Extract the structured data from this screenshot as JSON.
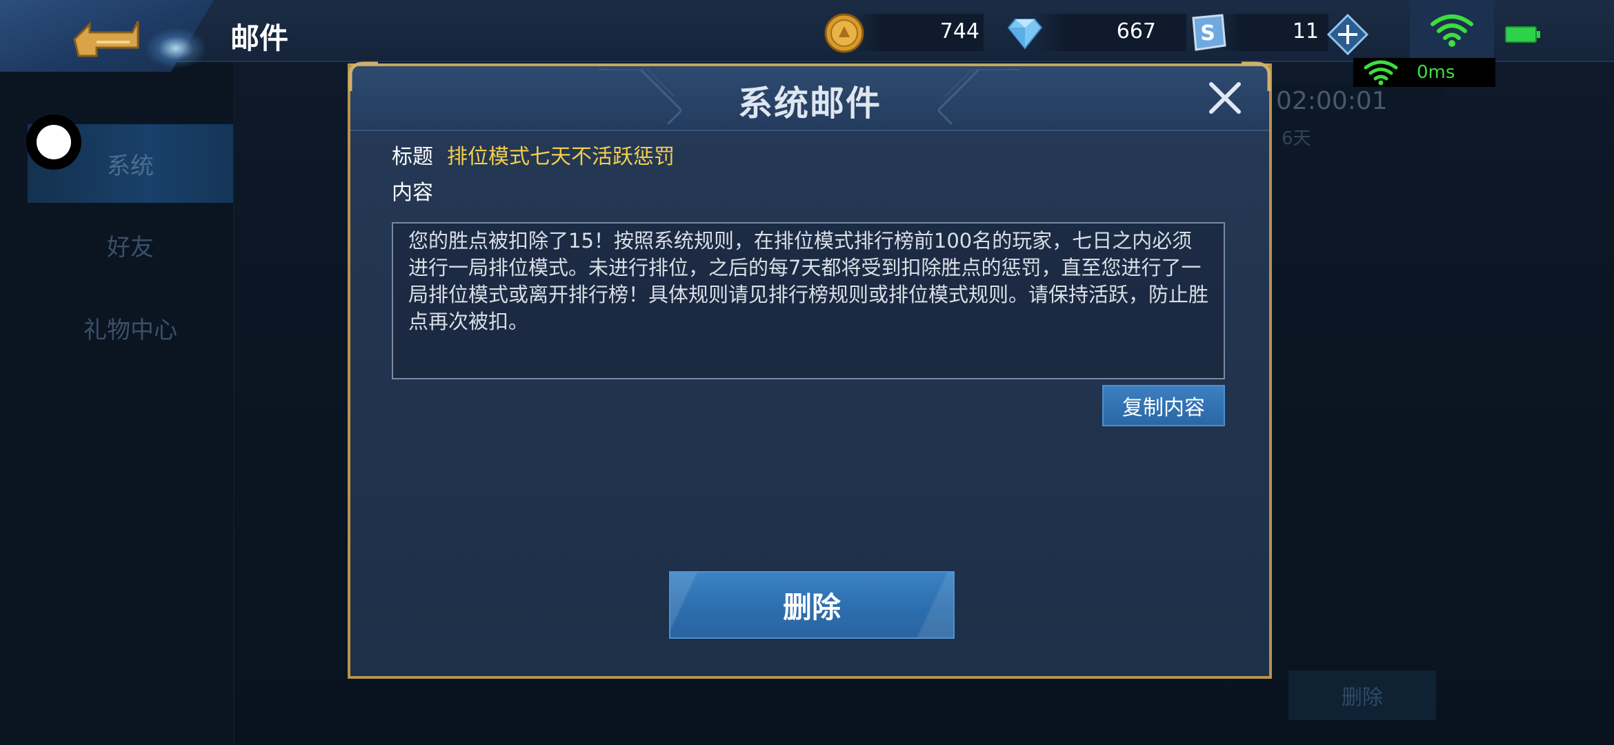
{
  "header": {
    "title": "邮件",
    "currencies": [
      {
        "icon": "gold-coin-icon",
        "value": "744"
      },
      {
        "icon": "diamond-icon",
        "value": "667"
      },
      {
        "icon": "voucher-icon",
        "value": "11"
      }
    ]
  },
  "network": {
    "ping": "0ms"
  },
  "sidebar": {
    "items": [
      {
        "label": "系统",
        "active": true
      },
      {
        "label": "好友",
        "active": false
      },
      {
        "label": "礼物中心",
        "active": false
      }
    ]
  },
  "background": {
    "timer": "02:00:01",
    "days": "6天",
    "delete_label": "删除"
  },
  "dialog": {
    "title": "系统邮件",
    "subject_label": "标题",
    "subject": "排位模式七天不活跃惩罚",
    "content_label": "内容",
    "content": "您的胜点被扣除了15！按照系统规则，在排位模式排行榜前100名的玩家，七日之内必须进行一局排位模式。未进行排位，之后的每7天都将受到扣除胜点的惩罚，直至您进行了一局排位模式或离开排行榜！具体规则请见排行榜规则或排位模式规则。请保持活跃，防止胜点再次被扣。",
    "copy_label": "复制内容",
    "delete_label": "删除"
  },
  "colors": {
    "subject": "#f3cf4a",
    "gold_border": "#b8944e",
    "button_blue": "#2d6eae",
    "ping_green": "#3dde3d"
  }
}
